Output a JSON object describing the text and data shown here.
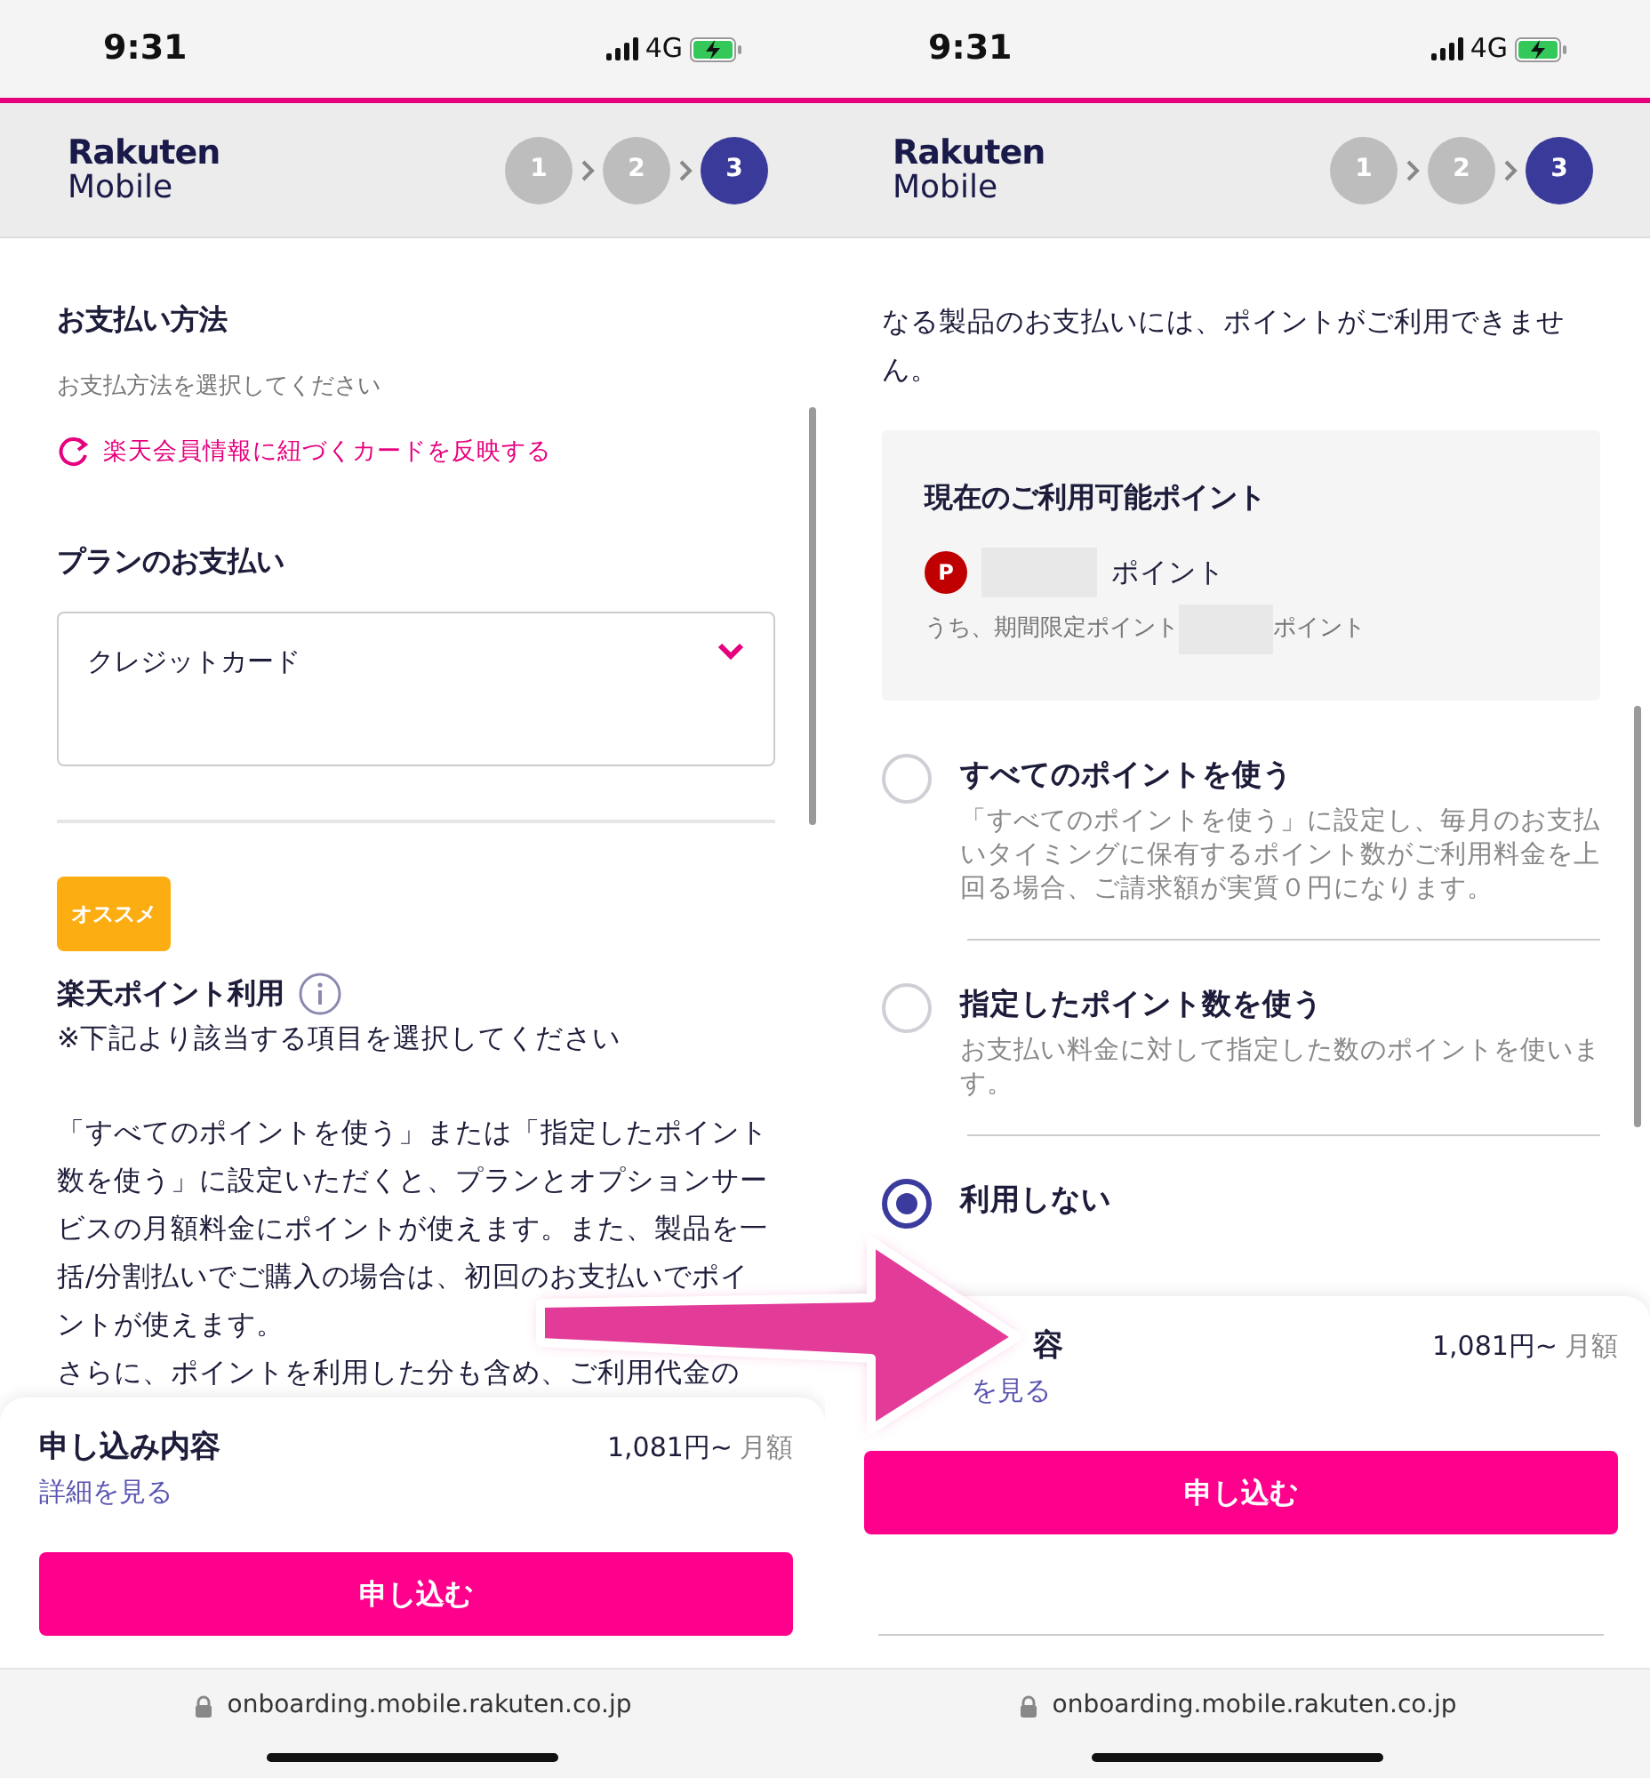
{
  "panels": [
    {
      "status": {
        "time": "9:31",
        "network": "4G"
      },
      "logo": {
        "line1": "Rakuten",
        "line2": "Mobile"
      },
      "steps": [
        {
          "label": "1",
          "selected": false
        },
        {
          "label": "2",
          "selected": false
        },
        {
          "label": "3",
          "selected": true
        }
      ],
      "content": [
        {
          "kind": "heading",
          "text": "お支払い方法"
        },
        {
          "kind": "hint",
          "text": "お支払方法を選択してください"
        },
        {
          "kind": "action",
          "text": "楽天会員情報に紐づくカードを反映する"
        },
        {
          "kind": "heading",
          "text": "プランのお支払い"
        },
        {
          "kind": "select",
          "value": "クレジットカード"
        },
        {
          "kind": "divider"
        },
        {
          "kind": "badge",
          "text": "オススメ"
        },
        {
          "kind": "heading_info",
          "text": "楽天ポイント利用"
        },
        {
          "kind": "text",
          "text": "※下記より該当する項目を選択してください"
        },
        {
          "kind": "paragraph",
          "text": "「すべてのポイントを使う」または「指定したポイント数を使う」に設定いただくと、プランとオプションサービスの月額料金にポイントが使えます。また、製品を一括/分割払いでご購入の場合は、初回のお支払いでポイントが使えます。"
        },
        {
          "kind": "text",
          "text": "さらに、ポイントを利用した分も含め、ご利用代金の"
        }
      ],
      "footer": {
        "title": "申し込み内容",
        "price": "1,081円~",
        "period": "月額",
        "link": "詳細を見る",
        "button": "申し込む"
      },
      "url": "onboarding.mobile.rakuten.co.jp"
    },
    {
      "status": {
        "time": "9:31",
        "network": "4G"
      },
      "logo": {
        "line1": "Rakuten",
        "line2": "Mobile"
      },
      "steps": [
        {
          "label": "1",
          "selected": false
        },
        {
          "label": "2",
          "selected": false
        },
        {
          "label": "3",
          "selected": true
        }
      ],
      "content": [
        {
          "kind": "text",
          "text": "なる製品のお支払いには、ポイントがご利用できません。"
        },
        {
          "kind": "points_box",
          "title": "現在のご利用可能ポイント",
          "badge": "P",
          "unit": "ポイント",
          "sub_label": "うち、期間限定ポイント",
          "sub_unit": "ポイント"
        },
        {
          "kind": "radio",
          "label": "すべてのポイントを使う",
          "description": "「すべてのポイントを使う」に設定し、毎月のお支払いタイミングに保有するポイント数がご利用料金を上回る場合、ご請求額が実質０円になります。",
          "selected": false
        },
        {
          "kind": "radio",
          "label": "指定したポイント数を使う",
          "description": "お支払い料金に対して指定した数のポイントを使います。",
          "selected": false
        },
        {
          "kind": "radio",
          "label": "利用しない",
          "selected": true
        }
      ],
      "footer": {
        "title": "容",
        "price": "1,081円~",
        "period": "月額",
        "link": "を見る",
        "button": "申し込む"
      },
      "url": "onboarding.mobile.rakuten.co.jp"
    }
  ]
}
